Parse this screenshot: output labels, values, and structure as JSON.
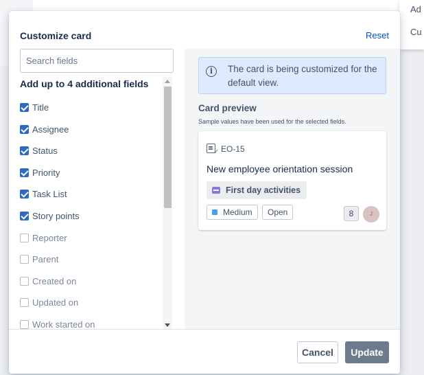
{
  "background": {
    "menu_items": [
      "Ad",
      "Cu"
    ]
  },
  "dialog": {
    "title": "Customize card",
    "reset_label": "Reset"
  },
  "search": {
    "placeholder": "Search fields",
    "value": ""
  },
  "fields": {
    "heading": "Add up to 4 additional fields",
    "items": [
      {
        "label": "Title",
        "checked": true
      },
      {
        "label": "Assignee",
        "checked": true
      },
      {
        "label": "Status",
        "checked": true
      },
      {
        "label": "Priority",
        "checked": true
      },
      {
        "label": "Task List",
        "checked": true
      },
      {
        "label": "Story points",
        "checked": true
      },
      {
        "label": "Reporter",
        "checked": false
      },
      {
        "label": "Parent",
        "checked": false
      },
      {
        "label": "Created on",
        "checked": false
      },
      {
        "label": "Updated on",
        "checked": false
      },
      {
        "label": "Work started on",
        "checked": false
      }
    ]
  },
  "info": {
    "icon": "info-icon",
    "text": "The card is being customized for the default view."
  },
  "preview": {
    "title": "Card preview",
    "subtitle": "Sample values have been used for the selected fields.",
    "card": {
      "type_icon": "task-icon",
      "key": "EO-15",
      "title": "New employee orientation session",
      "task_list": "First day activities",
      "priority": "Medium",
      "status": "Open",
      "story_points": "8",
      "avatar_initial": "J"
    }
  },
  "footer": {
    "cancel_label": "Cancel",
    "update_label": "Update"
  },
  "colors": {
    "accent": "#0052cc",
    "checkbox_checked": "#2c6bbf",
    "info_background": "#deebff",
    "update_button": "#6b7b8c",
    "task_list_icon": "#8777d9",
    "priority_medium": "#4c9aff"
  }
}
